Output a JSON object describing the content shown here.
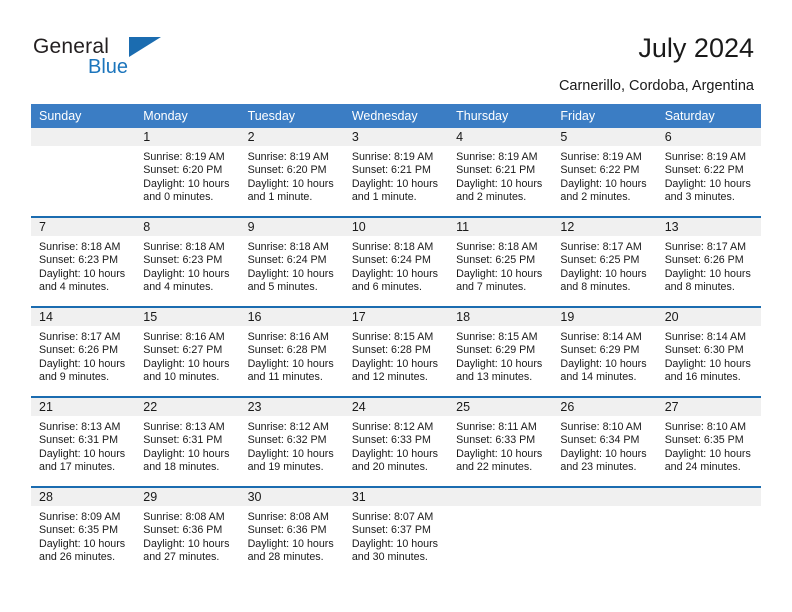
{
  "brand": {
    "name_part1": "General",
    "name_part2": "Blue",
    "accent_color": "#1b6cb0",
    "logo_icon": "triangle-mark"
  },
  "header": {
    "title": "July 2024",
    "subtitle": "Carnerillo, Cordoba, Argentina"
  },
  "colors": {
    "header_band": "#3b7dc4",
    "week_separator": "#1b6cb0",
    "daynum_strip": "#f0f0f0",
    "text": "#1a1a1a"
  },
  "weekday_headers": [
    "Sunday",
    "Monday",
    "Tuesday",
    "Wednesday",
    "Thursday",
    "Friday",
    "Saturday"
  ],
  "weeks": [
    {
      "days": [
        {
          "date": "",
          "empty": true,
          "sunrise": "",
          "sunset": "",
          "daylight_line1": "",
          "daylight_line2": ""
        },
        {
          "date": "1",
          "empty": false,
          "sunrise": "Sunrise: 8:19 AM",
          "sunset": "Sunset: 6:20 PM",
          "daylight_line1": "Daylight: 10 hours",
          "daylight_line2": "and 0 minutes."
        },
        {
          "date": "2",
          "empty": false,
          "sunrise": "Sunrise: 8:19 AM",
          "sunset": "Sunset: 6:20 PM",
          "daylight_line1": "Daylight: 10 hours",
          "daylight_line2": "and 1 minute."
        },
        {
          "date": "3",
          "empty": false,
          "sunrise": "Sunrise: 8:19 AM",
          "sunset": "Sunset: 6:21 PM",
          "daylight_line1": "Daylight: 10 hours",
          "daylight_line2": "and 1 minute."
        },
        {
          "date": "4",
          "empty": false,
          "sunrise": "Sunrise: 8:19 AM",
          "sunset": "Sunset: 6:21 PM",
          "daylight_line1": "Daylight: 10 hours",
          "daylight_line2": "and 2 minutes."
        },
        {
          "date": "5",
          "empty": false,
          "sunrise": "Sunrise: 8:19 AM",
          "sunset": "Sunset: 6:22 PM",
          "daylight_line1": "Daylight: 10 hours",
          "daylight_line2": "and 2 minutes."
        },
        {
          "date": "6",
          "empty": false,
          "sunrise": "Sunrise: 8:19 AM",
          "sunset": "Sunset: 6:22 PM",
          "daylight_line1": "Daylight: 10 hours",
          "daylight_line2": "and 3 minutes."
        }
      ]
    },
    {
      "days": [
        {
          "date": "7",
          "empty": false,
          "sunrise": "Sunrise: 8:18 AM",
          "sunset": "Sunset: 6:23 PM",
          "daylight_line1": "Daylight: 10 hours",
          "daylight_line2": "and 4 minutes."
        },
        {
          "date": "8",
          "empty": false,
          "sunrise": "Sunrise: 8:18 AM",
          "sunset": "Sunset: 6:23 PM",
          "daylight_line1": "Daylight: 10 hours",
          "daylight_line2": "and 4 minutes."
        },
        {
          "date": "9",
          "empty": false,
          "sunrise": "Sunrise: 8:18 AM",
          "sunset": "Sunset: 6:24 PM",
          "daylight_line1": "Daylight: 10 hours",
          "daylight_line2": "and 5 minutes."
        },
        {
          "date": "10",
          "empty": false,
          "sunrise": "Sunrise: 8:18 AM",
          "sunset": "Sunset: 6:24 PM",
          "daylight_line1": "Daylight: 10 hours",
          "daylight_line2": "and 6 minutes."
        },
        {
          "date": "11",
          "empty": false,
          "sunrise": "Sunrise: 8:18 AM",
          "sunset": "Sunset: 6:25 PM",
          "daylight_line1": "Daylight: 10 hours",
          "daylight_line2": "and 7 minutes."
        },
        {
          "date": "12",
          "empty": false,
          "sunrise": "Sunrise: 8:17 AM",
          "sunset": "Sunset: 6:25 PM",
          "daylight_line1": "Daylight: 10 hours",
          "daylight_line2": "and 8 minutes."
        },
        {
          "date": "13",
          "empty": false,
          "sunrise": "Sunrise: 8:17 AM",
          "sunset": "Sunset: 6:26 PM",
          "daylight_line1": "Daylight: 10 hours",
          "daylight_line2": "and 8 minutes."
        }
      ]
    },
    {
      "days": [
        {
          "date": "14",
          "empty": false,
          "sunrise": "Sunrise: 8:17 AM",
          "sunset": "Sunset: 6:26 PM",
          "daylight_line1": "Daylight: 10 hours",
          "daylight_line2": "and 9 minutes."
        },
        {
          "date": "15",
          "empty": false,
          "sunrise": "Sunrise: 8:16 AM",
          "sunset": "Sunset: 6:27 PM",
          "daylight_line1": "Daylight: 10 hours",
          "daylight_line2": "and 10 minutes."
        },
        {
          "date": "16",
          "empty": false,
          "sunrise": "Sunrise: 8:16 AM",
          "sunset": "Sunset: 6:28 PM",
          "daylight_line1": "Daylight: 10 hours",
          "daylight_line2": "and 11 minutes."
        },
        {
          "date": "17",
          "empty": false,
          "sunrise": "Sunrise: 8:15 AM",
          "sunset": "Sunset: 6:28 PM",
          "daylight_line1": "Daylight: 10 hours",
          "daylight_line2": "and 12 minutes."
        },
        {
          "date": "18",
          "empty": false,
          "sunrise": "Sunrise: 8:15 AM",
          "sunset": "Sunset: 6:29 PM",
          "daylight_line1": "Daylight: 10 hours",
          "daylight_line2": "and 13 minutes."
        },
        {
          "date": "19",
          "empty": false,
          "sunrise": "Sunrise: 8:14 AM",
          "sunset": "Sunset: 6:29 PM",
          "daylight_line1": "Daylight: 10 hours",
          "daylight_line2": "and 14 minutes."
        },
        {
          "date": "20",
          "empty": false,
          "sunrise": "Sunrise: 8:14 AM",
          "sunset": "Sunset: 6:30 PM",
          "daylight_line1": "Daylight: 10 hours",
          "daylight_line2": "and 16 minutes."
        }
      ]
    },
    {
      "days": [
        {
          "date": "21",
          "empty": false,
          "sunrise": "Sunrise: 8:13 AM",
          "sunset": "Sunset: 6:31 PM",
          "daylight_line1": "Daylight: 10 hours",
          "daylight_line2": "and 17 minutes."
        },
        {
          "date": "22",
          "empty": false,
          "sunrise": "Sunrise: 8:13 AM",
          "sunset": "Sunset: 6:31 PM",
          "daylight_line1": "Daylight: 10 hours",
          "daylight_line2": "and 18 minutes."
        },
        {
          "date": "23",
          "empty": false,
          "sunrise": "Sunrise: 8:12 AM",
          "sunset": "Sunset: 6:32 PM",
          "daylight_line1": "Daylight: 10 hours",
          "daylight_line2": "and 19 minutes."
        },
        {
          "date": "24",
          "empty": false,
          "sunrise": "Sunrise: 8:12 AM",
          "sunset": "Sunset: 6:33 PM",
          "daylight_line1": "Daylight: 10 hours",
          "daylight_line2": "and 20 minutes."
        },
        {
          "date": "25",
          "empty": false,
          "sunrise": "Sunrise: 8:11 AM",
          "sunset": "Sunset: 6:33 PM",
          "daylight_line1": "Daylight: 10 hours",
          "daylight_line2": "and 22 minutes."
        },
        {
          "date": "26",
          "empty": false,
          "sunrise": "Sunrise: 8:10 AM",
          "sunset": "Sunset: 6:34 PM",
          "daylight_line1": "Daylight: 10 hours",
          "daylight_line2": "and 23 minutes."
        },
        {
          "date": "27",
          "empty": false,
          "sunrise": "Sunrise: 8:10 AM",
          "sunset": "Sunset: 6:35 PM",
          "daylight_line1": "Daylight: 10 hours",
          "daylight_line2": "and 24 minutes."
        }
      ]
    },
    {
      "days": [
        {
          "date": "28",
          "empty": false,
          "sunrise": "Sunrise: 8:09 AM",
          "sunset": "Sunset: 6:35 PM",
          "daylight_line1": "Daylight: 10 hours",
          "daylight_line2": "and 26 minutes."
        },
        {
          "date": "29",
          "empty": false,
          "sunrise": "Sunrise: 8:08 AM",
          "sunset": "Sunset: 6:36 PM",
          "daylight_line1": "Daylight: 10 hours",
          "daylight_line2": "and 27 minutes."
        },
        {
          "date": "30",
          "empty": false,
          "sunrise": "Sunrise: 8:08 AM",
          "sunset": "Sunset: 6:36 PM",
          "daylight_line1": "Daylight: 10 hours",
          "daylight_line2": "and 28 minutes."
        },
        {
          "date": "31",
          "empty": false,
          "sunrise": "Sunrise: 8:07 AM",
          "sunset": "Sunset: 6:37 PM",
          "daylight_line1": "Daylight: 10 hours",
          "daylight_line2": "and 30 minutes."
        },
        {
          "date": "",
          "empty": true,
          "sunrise": "",
          "sunset": "",
          "daylight_line1": "",
          "daylight_line2": ""
        },
        {
          "date": "",
          "empty": true,
          "sunrise": "",
          "sunset": "",
          "daylight_line1": "",
          "daylight_line2": ""
        },
        {
          "date": "",
          "empty": true,
          "sunrise": "",
          "sunset": "",
          "daylight_line1": "",
          "daylight_line2": ""
        }
      ]
    }
  ]
}
